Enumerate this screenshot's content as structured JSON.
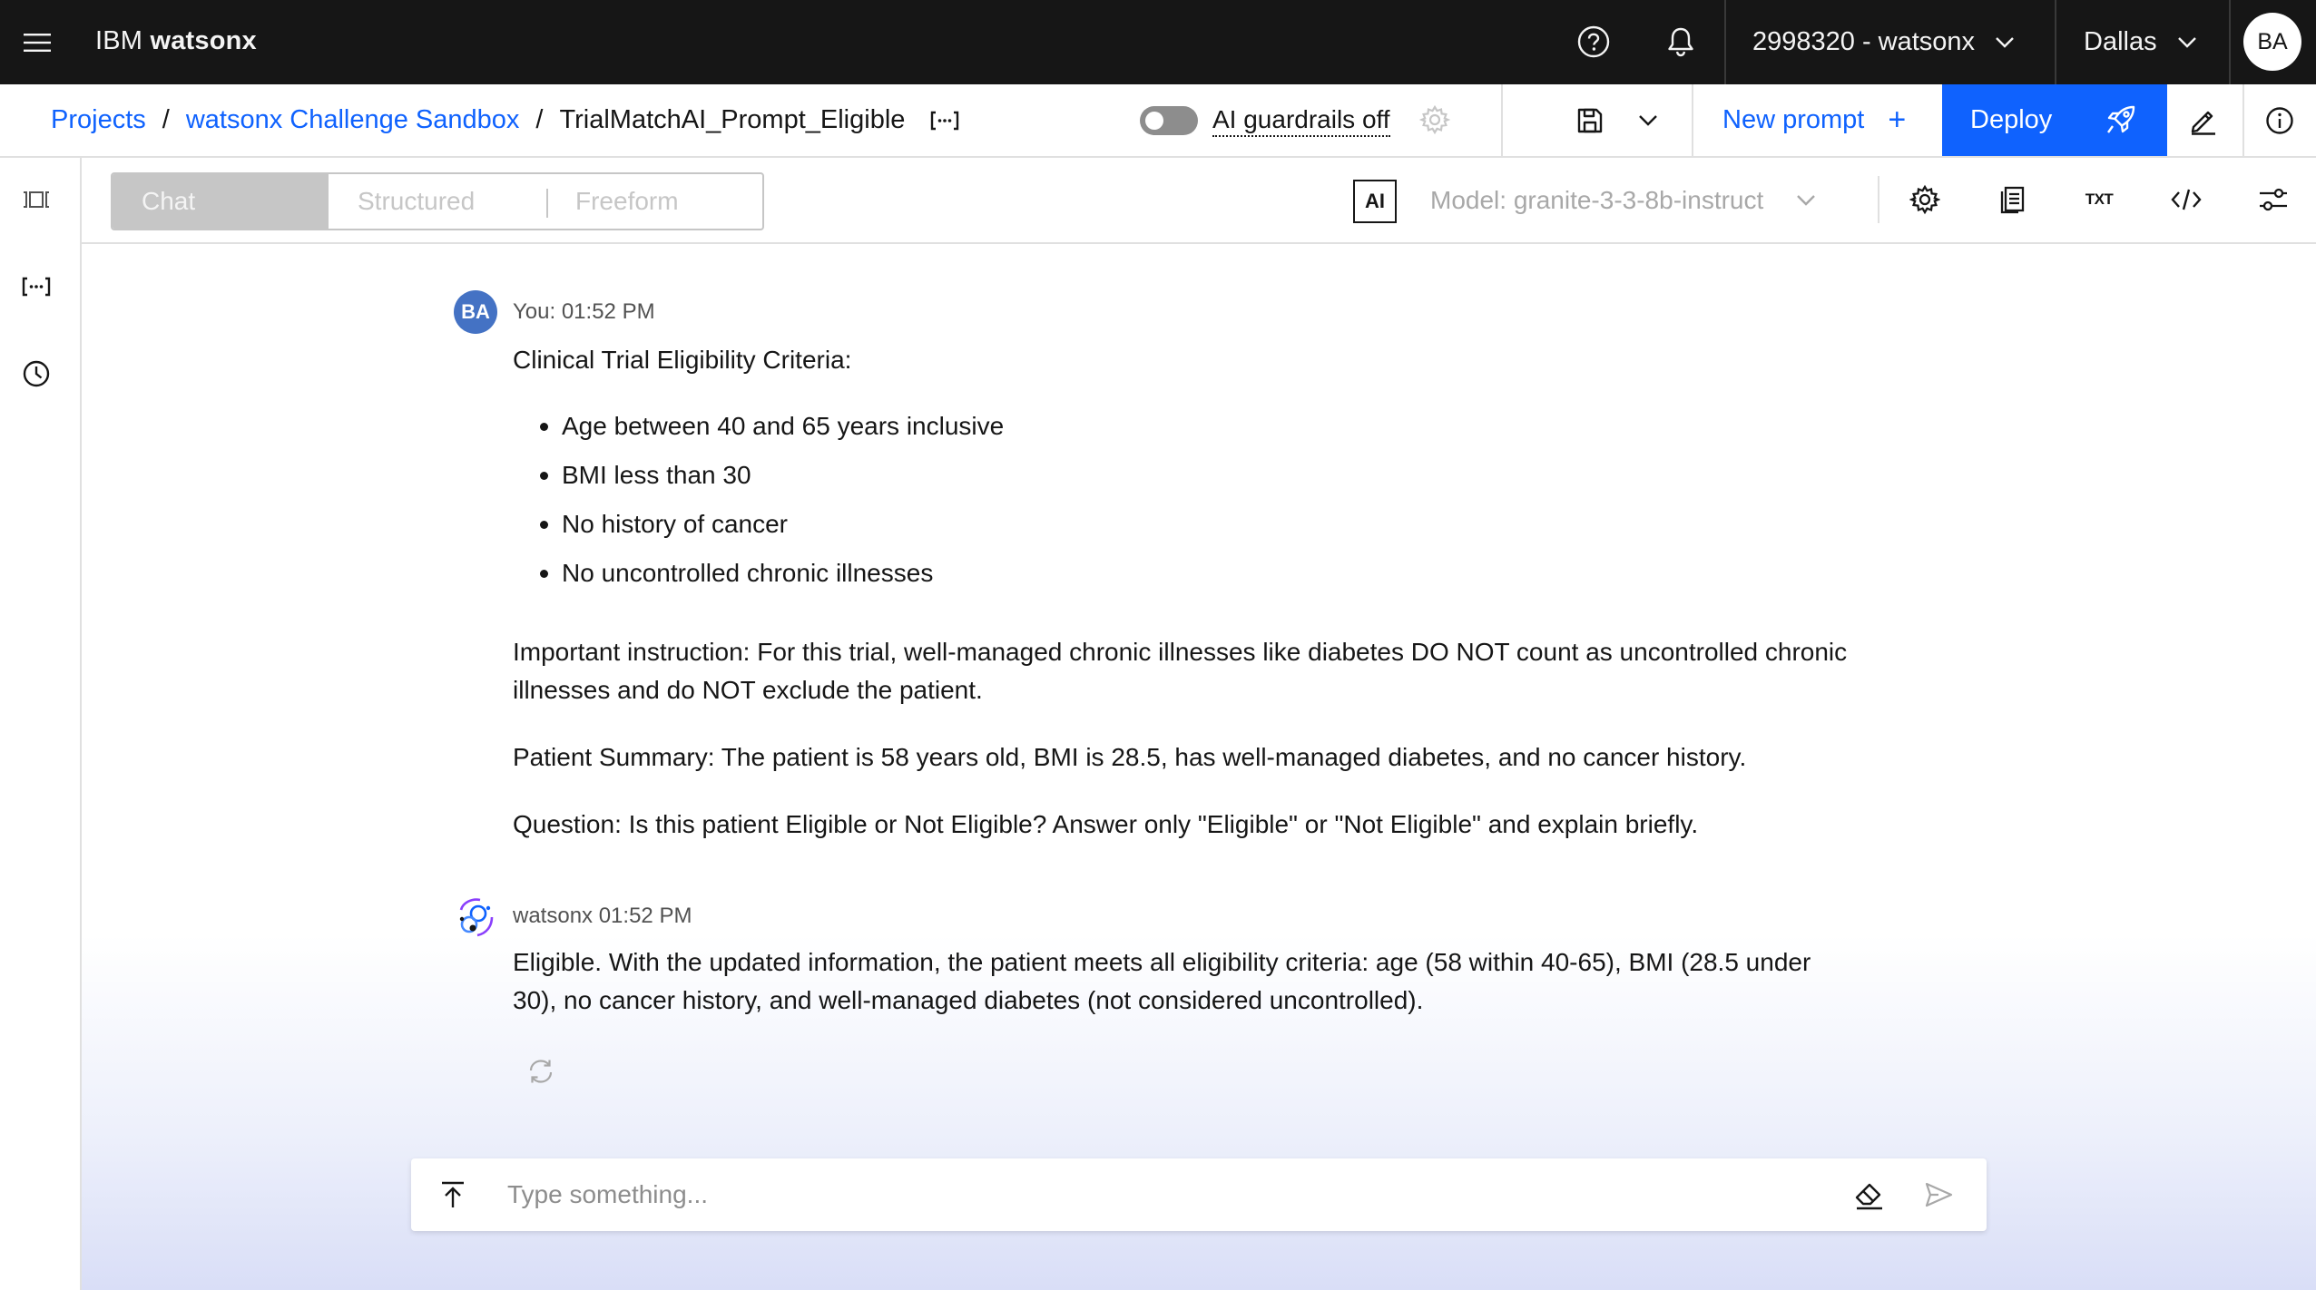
{
  "header": {
    "brand_prefix": "IBM",
    "brand_name": "watsonx",
    "account": "2998320 - watsonx",
    "region": "Dallas",
    "user_initials": "BA"
  },
  "breadcrumb": {
    "projects": "Projects",
    "project": "watsonx Challenge Sandbox",
    "separator": "/",
    "current": "TrialMatchAI_Prompt_Eligible"
  },
  "guardrails": {
    "label": "AI guardrails off",
    "enabled": false
  },
  "actions": {
    "new_prompt": "New prompt",
    "new_prompt_plus": "+",
    "deploy": "Deploy"
  },
  "modes": {
    "chat": "Chat",
    "structured": "Structured",
    "freeform": "Freeform",
    "active": "Chat"
  },
  "model": {
    "badge": "AI",
    "label": "Model: granite-3-3-8b-instruct"
  },
  "toolbar": {
    "txt_label": "TXT"
  },
  "messages": {
    "user": {
      "initials": "BA",
      "meta": "You: 01:52 PM",
      "heading": "Clinical Trial Eligibility Criteria:",
      "criteria": [
        "Age between 40 and 65 years inclusive",
        "BMI less than 30",
        "No history of cancer",
        "No uncontrolled chronic illnesses"
      ],
      "instruction_line1": "Important instruction: For this trial, well-managed chronic illnesses like diabetes DO NOT count as uncontrolled chronic",
      "instruction_line2": "illnesses and do NOT exclude the patient.",
      "summary": "Patient Summary: The patient is 58 years old, BMI is 28.5, has well-managed diabetes, and no cancer history.",
      "question": "Question: Is this patient Eligible or Not Eligible? Answer only \"Eligible\" or \"Not Eligible\" and explain briefly."
    },
    "assistant": {
      "meta": "watsonx 01:52 PM",
      "line1": "Eligible. With the updated information, the patient meets all eligibility criteria: age (58 within 40-65), BMI (28.5 under",
      "line2": "30), no cancer history, and well-managed diabetes (not considered uncontrolled)."
    }
  },
  "composer": {
    "placeholder": "Type something...",
    "value": ""
  },
  "colors": {
    "header_bg": "#161616",
    "link_blue": "#0f62fe",
    "deploy_bg": "#0f62fe",
    "user_avatar": "#4472c4",
    "disabled_text": "#c6c6c6"
  },
  "icons": {
    "header": [
      "menu-icon",
      "help-icon",
      "notification-icon",
      "chevron-down-icon"
    ],
    "crumbbar": [
      "prompt-variables-icon",
      "settings-icon",
      "save-icon",
      "chevron-down-icon",
      "rocket-icon",
      "edit-icon",
      "info-icon"
    ],
    "rail": [
      "side-panel-icon",
      "prompt-variables-icon",
      "history-icon"
    ],
    "toolbar": [
      "parameters-icon",
      "view-text-icon",
      "txt-icon",
      "code-icon",
      "sliders-icon"
    ],
    "chat": [
      "watsonx-logo-icon",
      "regenerate-icon",
      "upload-icon",
      "eraser-icon",
      "send-icon"
    ]
  }
}
